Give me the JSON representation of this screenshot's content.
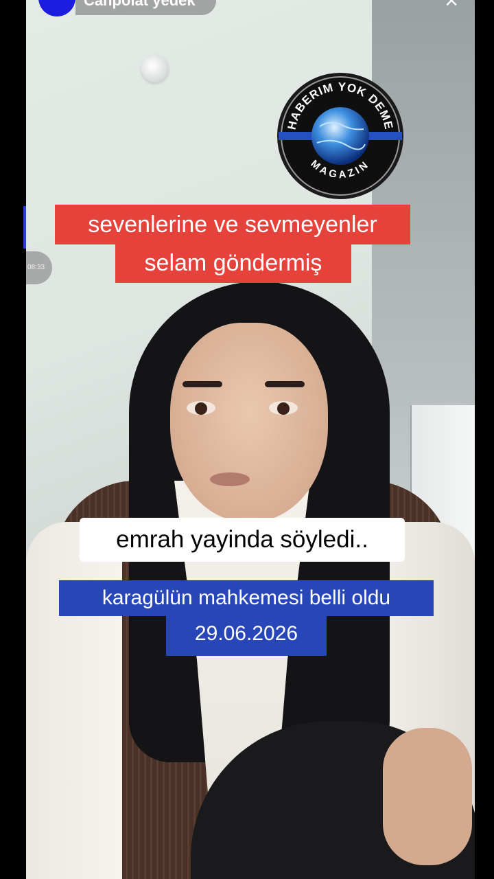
{
  "header": {
    "username": "Canpolat yedek",
    "close_symbol": "×",
    "timer": "08:33"
  },
  "logo": {
    "top_text": "HABERIM YOK DEME",
    "bottom_text": "MAGAZIN"
  },
  "captions": {
    "red_line1": "sevenlerine ve sevmeyenler",
    "red_line2": "selam göndermiş",
    "white": "emrah yayinda söyledi..",
    "blue_line1": "karagülün mahkemesi belli oldu",
    "blue_line2": "29.06.2026"
  },
  "colors": {
    "red_caption": "#e5423b",
    "blue_caption": "#2746b8",
    "avatar": "#1d1de0"
  }
}
